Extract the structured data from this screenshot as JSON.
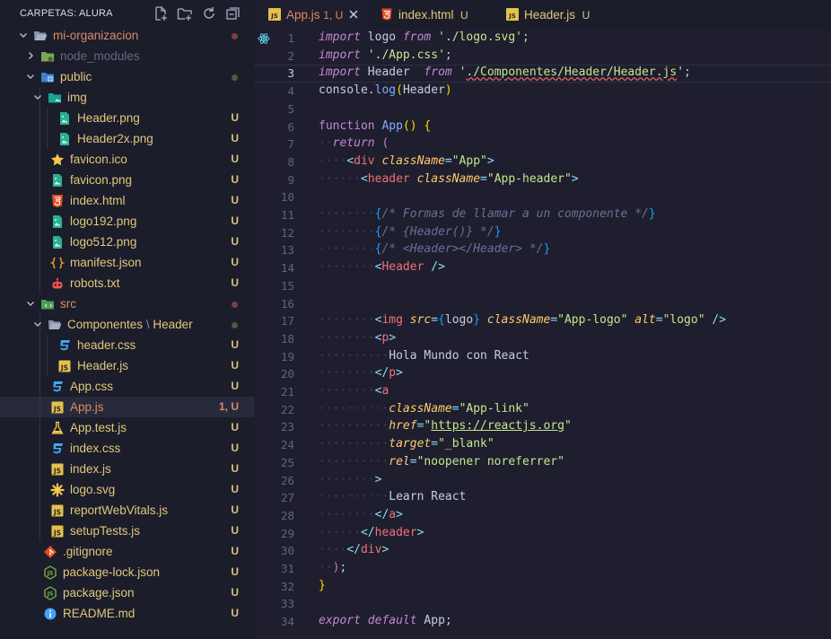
{
  "sidebar": {
    "title": "CARPETAS: ALURA",
    "actions": [
      {
        "name": "new-file-button"
      },
      {
        "name": "new-folder-button"
      },
      {
        "name": "refresh-button"
      },
      {
        "name": "collapse-all-button"
      }
    ],
    "items": [
      {
        "label": "mi-organizacion",
        "depth": 1,
        "type": "folder",
        "open": true,
        "icon": "folder-open",
        "status": "dot",
        "dotColor": "#7b3f3f",
        "color": "mod"
      },
      {
        "label": "node_modules",
        "depth": 2,
        "type": "folder",
        "open": false,
        "icon": "folder-node",
        "status": "",
        "color": "dim"
      },
      {
        "label": "public",
        "depth": 2,
        "type": "folder",
        "open": true,
        "icon": "folder-public",
        "status": "dot",
        "dotColor": "#4f5a3f",
        "color": "u"
      },
      {
        "label": "img",
        "depth": 3,
        "type": "folder",
        "open": true,
        "icon": "folder-img",
        "status": "",
        "color": "u"
      },
      {
        "label": "Header.png",
        "depth": 4,
        "type": "file",
        "icon": "image",
        "status": "U",
        "color": "u"
      },
      {
        "label": "Header2x.png",
        "depth": 4,
        "type": "file",
        "icon": "image",
        "status": "U",
        "color": "u"
      },
      {
        "label": "favicon.ico",
        "depth": 3,
        "type": "file",
        "icon": "star",
        "status": "U",
        "color": "u"
      },
      {
        "label": "favicon.png",
        "depth": 3,
        "type": "file",
        "icon": "image",
        "status": "U",
        "color": "u"
      },
      {
        "label": "index.html",
        "depth": 3,
        "type": "file",
        "icon": "html5",
        "status": "U",
        "color": "u"
      },
      {
        "label": "logo192.png",
        "depth": 3,
        "type": "file",
        "icon": "image",
        "status": "U",
        "color": "u"
      },
      {
        "label": "logo512.png",
        "depth": 3,
        "type": "file",
        "icon": "image",
        "status": "U",
        "color": "u"
      },
      {
        "label": "manifest.json",
        "depth": 3,
        "type": "file",
        "icon": "json-braces",
        "status": "U",
        "color": "u"
      },
      {
        "label": "robots.txt",
        "depth": 3,
        "type": "file",
        "icon": "robot",
        "status": "U",
        "color": "u"
      },
      {
        "label": "src",
        "depth": 2,
        "type": "folder",
        "open": true,
        "icon": "folder-src",
        "status": "dot",
        "dotColor": "#7b3f3f",
        "color": "mod"
      },
      {
        "label": "Componentes",
        "label2": "Header",
        "depth": 3,
        "type": "folder",
        "open": true,
        "icon": "folder-open",
        "status": "dot",
        "dotColor": "#4f5a3f",
        "color": "u"
      },
      {
        "label": "header.css",
        "depth": 4,
        "type": "file",
        "icon": "css3",
        "status": "U",
        "color": "u"
      },
      {
        "label": "Header.js",
        "depth": 4,
        "type": "file",
        "icon": "js",
        "status": "U",
        "color": "u"
      },
      {
        "label": "App.css",
        "depth": 3,
        "type": "file",
        "icon": "css3",
        "status": "U",
        "color": "u"
      },
      {
        "label": "App.js",
        "depth": 3,
        "type": "file",
        "icon": "js",
        "status": "1, U",
        "color": "mod",
        "active": true
      },
      {
        "label": "App.test.js",
        "depth": 3,
        "type": "file",
        "icon": "flask",
        "status": "U",
        "color": "u"
      },
      {
        "label": "index.css",
        "depth": 3,
        "type": "file",
        "icon": "css3",
        "status": "U",
        "color": "u"
      },
      {
        "label": "index.js",
        "depth": 3,
        "type": "file",
        "icon": "js",
        "status": "U",
        "color": "u"
      },
      {
        "label": "logo.svg",
        "depth": 3,
        "type": "file",
        "icon": "svg-asterisk",
        "status": "U",
        "color": "u"
      },
      {
        "label": "reportWebVitals.js",
        "depth": 3,
        "type": "file",
        "icon": "js",
        "status": "U",
        "color": "u"
      },
      {
        "label": "setupTests.js",
        "depth": 3,
        "type": "file",
        "icon": "js",
        "status": "U",
        "color": "u"
      },
      {
        "label": ".gitignore",
        "depth": 2,
        "type": "file",
        "icon": "git",
        "status": "U",
        "color": "u"
      },
      {
        "label": "package-lock.json",
        "depth": 2,
        "type": "file",
        "icon": "nodejs",
        "status": "U",
        "color": "u"
      },
      {
        "label": "package.json",
        "depth": 2,
        "type": "file",
        "icon": "nodejs",
        "status": "U",
        "color": "u"
      },
      {
        "label": "README.md",
        "depth": 2,
        "type": "file",
        "icon": "info",
        "status": "U",
        "color": "u"
      }
    ]
  },
  "tabs": [
    {
      "label": "App.js",
      "status": "1, U",
      "icon": "js",
      "active": true
    },
    {
      "label": "index.html",
      "status": "U",
      "icon": "html5",
      "active": false
    },
    {
      "label": "Header.js",
      "status": "U",
      "icon": "js",
      "active": false
    }
  ],
  "editor": {
    "current_line": 3,
    "lines": [
      [
        [
          "kw",
          "import"
        ],
        [
          "p",
          " logo "
        ],
        [
          "kw",
          "from"
        ],
        [
          "p",
          " "
        ],
        [
          "str",
          "'./logo.svg'"
        ],
        [
          "p",
          ";"
        ]
      ],
      [
        [
          "kw",
          "import"
        ],
        [
          "p",
          " "
        ],
        [
          "str",
          "'./App.css'"
        ],
        [
          "p",
          ";"
        ]
      ],
      [
        [
          "kw",
          "import"
        ],
        [
          "p",
          " Header  "
        ],
        [
          "kw",
          "from"
        ],
        [
          "p",
          " "
        ],
        [
          "str",
          "'"
        ],
        [
          "strsq",
          "./Componentes/Header/Header.js"
        ],
        [
          "str",
          "'"
        ],
        [
          "p",
          ";"
        ]
      ],
      [
        [
          "p",
          "console."
        ],
        [
          "fn",
          "log"
        ],
        [
          "yel",
          "("
        ],
        [
          "p",
          "Header"
        ],
        [
          "yel",
          ")"
        ]
      ],
      [],
      [
        [
          "kwn",
          "function"
        ],
        [
          "p",
          " "
        ],
        [
          "fn",
          "App"
        ],
        [
          "yel",
          "()"
        ],
        [
          "p",
          " "
        ],
        [
          "yel",
          "{"
        ]
      ],
      [
        [
          "ws",
          "··"
        ],
        [
          "kw",
          "return"
        ],
        [
          "p",
          " "
        ],
        [
          "pink",
          "("
        ]
      ],
      [
        [
          "ws",
          "····"
        ],
        [
          "pun",
          "<"
        ],
        [
          "tag",
          "div"
        ],
        [
          "p",
          " "
        ],
        [
          "attr",
          "className"
        ],
        [
          "pun",
          "="
        ],
        [
          "str",
          "\"App\""
        ],
        [
          "pun",
          ">"
        ]
      ],
      [
        [
          "ws",
          "······"
        ],
        [
          "pun",
          "<"
        ],
        [
          "tag",
          "header"
        ],
        [
          "p",
          " "
        ],
        [
          "attr",
          "className"
        ],
        [
          "pun",
          "="
        ],
        [
          "str",
          "\"App-header\""
        ],
        [
          "pun",
          ">"
        ]
      ],
      [],
      [
        [
          "ws",
          "········"
        ],
        [
          "blu",
          "{"
        ],
        [
          "cmt",
          "/* Formas de llamar a un componente */"
        ],
        [
          "blu",
          "}"
        ]
      ],
      [
        [
          "ws",
          "········"
        ],
        [
          "blu",
          "{"
        ],
        [
          "cmt",
          "/* {Header()} */"
        ],
        [
          "blu",
          "}"
        ]
      ],
      [
        [
          "ws",
          "········"
        ],
        [
          "blu",
          "{"
        ],
        [
          "cmt",
          "/* <Header></Header> */"
        ],
        [
          "blu",
          "}"
        ]
      ],
      [
        [
          "ws",
          "········"
        ],
        [
          "pun",
          "<"
        ],
        [
          "tag",
          "Header"
        ],
        [
          "p",
          " "
        ],
        [
          "pun",
          "/>"
        ]
      ],
      [],
      [],
      [
        [
          "ws",
          "········"
        ],
        [
          "pun",
          "<"
        ],
        [
          "tag",
          "img"
        ],
        [
          "p",
          " "
        ],
        [
          "attr",
          "src"
        ],
        [
          "pun",
          "="
        ],
        [
          "blu",
          "{"
        ],
        [
          "p",
          "logo"
        ],
        [
          "blu",
          "}"
        ],
        [
          "p",
          " "
        ],
        [
          "attr",
          "className"
        ],
        [
          "pun",
          "="
        ],
        [
          "str",
          "\"App-logo\""
        ],
        [
          "p",
          " "
        ],
        [
          "attr",
          "alt"
        ],
        [
          "pun",
          "="
        ],
        [
          "str",
          "\"logo\""
        ],
        [
          "p",
          " "
        ],
        [
          "pun",
          "/>"
        ]
      ],
      [
        [
          "ws",
          "········"
        ],
        [
          "pun",
          "<"
        ],
        [
          "tag",
          "p"
        ],
        [
          "pun",
          ">"
        ]
      ],
      [
        [
          "ws",
          "··········"
        ],
        [
          "p",
          "Hola Mundo con React"
        ]
      ],
      [
        [
          "ws",
          "········"
        ],
        [
          "pun",
          "</"
        ],
        [
          "tag",
          "p"
        ],
        [
          "pun",
          ">"
        ]
      ],
      [
        [
          "ws",
          "········"
        ],
        [
          "pun",
          "<"
        ],
        [
          "tag",
          "a"
        ]
      ],
      [
        [
          "ws",
          "··········"
        ],
        [
          "attr",
          "className"
        ],
        [
          "pun",
          "="
        ],
        [
          "str",
          "\"App-link\""
        ]
      ],
      [
        [
          "ws",
          "··········"
        ],
        [
          "attr",
          "href"
        ],
        [
          "pun",
          "="
        ],
        [
          "str",
          "\""
        ],
        [
          "strlink",
          "https://reactjs.org"
        ],
        [
          "str",
          "\""
        ]
      ],
      [
        [
          "ws",
          "··········"
        ],
        [
          "attr",
          "target"
        ],
        [
          "pun",
          "="
        ],
        [
          "str",
          "\"_blank\""
        ]
      ],
      [
        [
          "ws",
          "··········"
        ],
        [
          "attr",
          "rel"
        ],
        [
          "pun",
          "="
        ],
        [
          "str",
          "\"noopener noreferrer\""
        ]
      ],
      [
        [
          "ws",
          "········"
        ],
        [
          "pun",
          ">"
        ]
      ],
      [
        [
          "ws",
          "··········"
        ],
        [
          "p",
          "Learn React"
        ]
      ],
      [
        [
          "ws",
          "········"
        ],
        [
          "pun",
          "</"
        ],
        [
          "tag",
          "a"
        ],
        [
          "pun",
          ">"
        ]
      ],
      [
        [
          "ws",
          "······"
        ],
        [
          "pun",
          "</"
        ],
        [
          "tag",
          "header"
        ],
        [
          "pun",
          ">"
        ]
      ],
      [
        [
          "ws",
          "····"
        ],
        [
          "pun",
          "</"
        ],
        [
          "tag",
          "div"
        ],
        [
          "pun",
          ">"
        ]
      ],
      [
        [
          "ws",
          "··"
        ],
        [
          "pink",
          ")"
        ],
        [
          "p",
          ";"
        ]
      ],
      [
        [
          "yel",
          "}"
        ]
      ],
      [],
      [
        [
          "kw",
          "export"
        ],
        [
          "p",
          " "
        ],
        [
          "kw",
          "default"
        ],
        [
          "p",
          " App;"
        ]
      ]
    ]
  },
  "colors": {
    "sidebar_bg": "#1b1d2b",
    "editor_bg": "#1e1e2e",
    "untracked": "#e2c879",
    "modified": "#dd8a66"
  }
}
